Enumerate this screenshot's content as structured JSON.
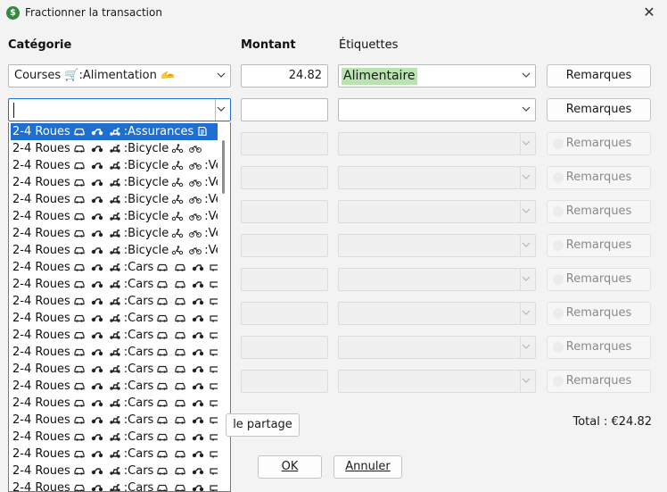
{
  "window": {
    "title": "Fractionner la transaction",
    "icon_glyph": "$",
    "close_glyph": "✕"
  },
  "headers": {
    "category": "Catégorie",
    "amount": "Montant",
    "tags": "Étiquettes"
  },
  "rows": [
    {
      "category": "Courses 🛒:Alimentation 🫴",
      "amount": "24.82",
      "tag": "Alimentaire",
      "notes": "Remarques",
      "enabled": true
    },
    {
      "category": "",
      "amount": "",
      "tag": "",
      "notes": "Remarques",
      "enabled": true,
      "focused": true
    },
    {
      "notes": "Remarques",
      "enabled": false
    },
    {
      "notes": "Remarques",
      "enabled": false
    },
    {
      "notes": "Remarques",
      "enabled": false
    },
    {
      "notes": "Remarques",
      "enabled": false
    },
    {
      "notes": "Remarques",
      "enabled": false
    },
    {
      "notes": "Remarques",
      "enabled": false
    },
    {
      "notes": "Remarques",
      "enabled": false
    },
    {
      "notes": "Remarques",
      "enabled": false
    }
  ],
  "dropdown": {
    "items": [
      {
        "prefix": "2-4 Roues",
        "suffix": ":Assurances",
        "icon": "document-icon",
        "selected": true
      },
      {
        "prefix": "2-4 Roues",
        "suffix": ":Bicycle",
        "icon": "bicycle-icon"
      },
      {
        "prefix": "2-4 Roues",
        "suffix": ":Bicycle",
        "icon": "bicycle-icon",
        "extra": ":Vé"
      },
      {
        "prefix": "2-4 Roues",
        "suffix": ":Bicycle",
        "icon": "bicycle-icon",
        "extra": ":Vé"
      },
      {
        "prefix": "2-4 Roues",
        "suffix": ":Bicycle",
        "icon": "bicycle-icon",
        "extra": ":Vé"
      },
      {
        "prefix": "2-4 Roues",
        "suffix": ":Bicycle",
        "icon": "bicycle-icon",
        "extra": ":Vé"
      },
      {
        "prefix": "2-4 Roues",
        "suffix": ":Bicycle",
        "icon": "bicycle-icon",
        "extra": ":Vé"
      },
      {
        "prefix": "2-4 Roues",
        "suffix": ":Bicycle",
        "icon": "bicycle-icon",
        "extra": ":Vé"
      },
      {
        "prefix": "2-4 Roues",
        "suffix": ":Cars",
        "icon": "car-icon"
      },
      {
        "prefix": "2-4 Roues",
        "suffix": ":Cars",
        "icon": "car-icon"
      },
      {
        "prefix": "2-4 Roues",
        "suffix": ":Cars",
        "icon": "car-icon"
      },
      {
        "prefix": "2-4 Roues",
        "suffix": ":Cars",
        "icon": "car-icon"
      },
      {
        "prefix": "2-4 Roues",
        "suffix": ":Cars",
        "icon": "car-icon"
      },
      {
        "prefix": "2-4 Roues",
        "suffix": ":Cars",
        "icon": "car-icon"
      },
      {
        "prefix": "2-4 Roues",
        "suffix": ":Cars",
        "icon": "car-icon"
      },
      {
        "prefix": "2-4 Roues",
        "suffix": ":Cars",
        "icon": "car-icon"
      },
      {
        "prefix": "2-4 Roues",
        "suffix": ":Cars",
        "icon": "car-icon"
      },
      {
        "prefix": "2-4 Roues",
        "suffix": ":Cars",
        "icon": "car-icon"
      },
      {
        "prefix": "2-4 Roues",
        "suffix": ":Cars",
        "icon": "car-icon"
      },
      {
        "prefix": "2-4 Roues",
        "suffix": ":Cars",
        "icon": "car-icon"
      },
      {
        "prefix": "2-4 Roues",
        "suffix": ":Cars",
        "icon": "car-icon"
      },
      {
        "prefix": "2-4 Roues",
        "suffix": ":Cars",
        "icon": "car-icon"
      }
    ]
  },
  "footer": {
    "split_button": "le partage",
    "total": "Total : €24.82",
    "ok": "OK",
    "cancel": "Annuler"
  },
  "colors": {
    "selection": "#1f6fd1",
    "tag_highlight": "#b9e3b0",
    "app_icon": "#2e8b3e"
  }
}
